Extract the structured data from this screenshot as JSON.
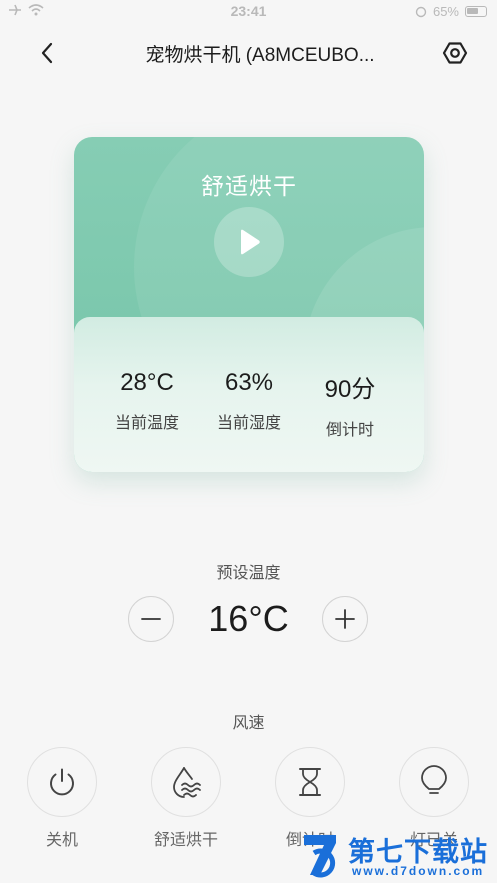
{
  "status_bar": {
    "time": "23:41",
    "battery": "65%"
  },
  "nav": {
    "title": "宠物烘干机 (A8MCEUBO..."
  },
  "card": {
    "mode": "舒适烘干",
    "stats": [
      {
        "value": "28°C",
        "label": "当前温度"
      },
      {
        "value": "63%",
        "label": "当前湿度"
      },
      {
        "value": "90分",
        "label": "倒计时"
      }
    ]
  },
  "preset": {
    "label": "预设温度",
    "value": "16°C"
  },
  "wind": {
    "label": "风速"
  },
  "controls": [
    {
      "icon": "power-icon",
      "label": "关机"
    },
    {
      "icon": "water-wave-icon",
      "label": "舒适烘干"
    },
    {
      "icon": "hourglass-icon",
      "label": "倒计时"
    },
    {
      "icon": "bulb-icon",
      "label": "灯已关"
    }
  ],
  "watermark": {
    "text": "第七下载站",
    "url": "www.d7down.com"
  },
  "colors": {
    "accent_green": "#7cc8ad",
    "watermark_blue": "#1a6fd9"
  }
}
